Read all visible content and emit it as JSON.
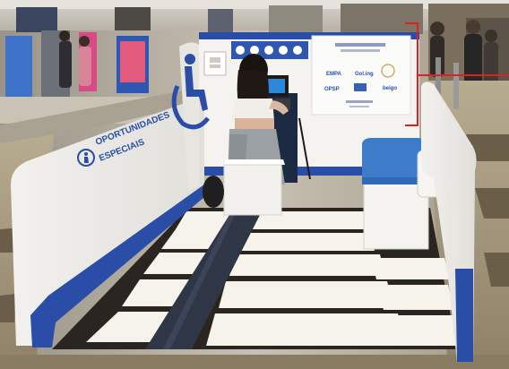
{
  "booth": {
    "sign_line1": "OPORTUNIDADES",
    "sign_line2": "ESPECIAIS"
  },
  "panel": {
    "logos": [
      "EMPA",
      "Gol.ing",
      "OPSP",
      "beigo"
    ]
  },
  "colors": {
    "booth_blue": "#2a4ea8",
    "seat_blue": "#3d7cc9",
    "annotation_red": "#e02020",
    "tactile_path": "#2f3646"
  }
}
